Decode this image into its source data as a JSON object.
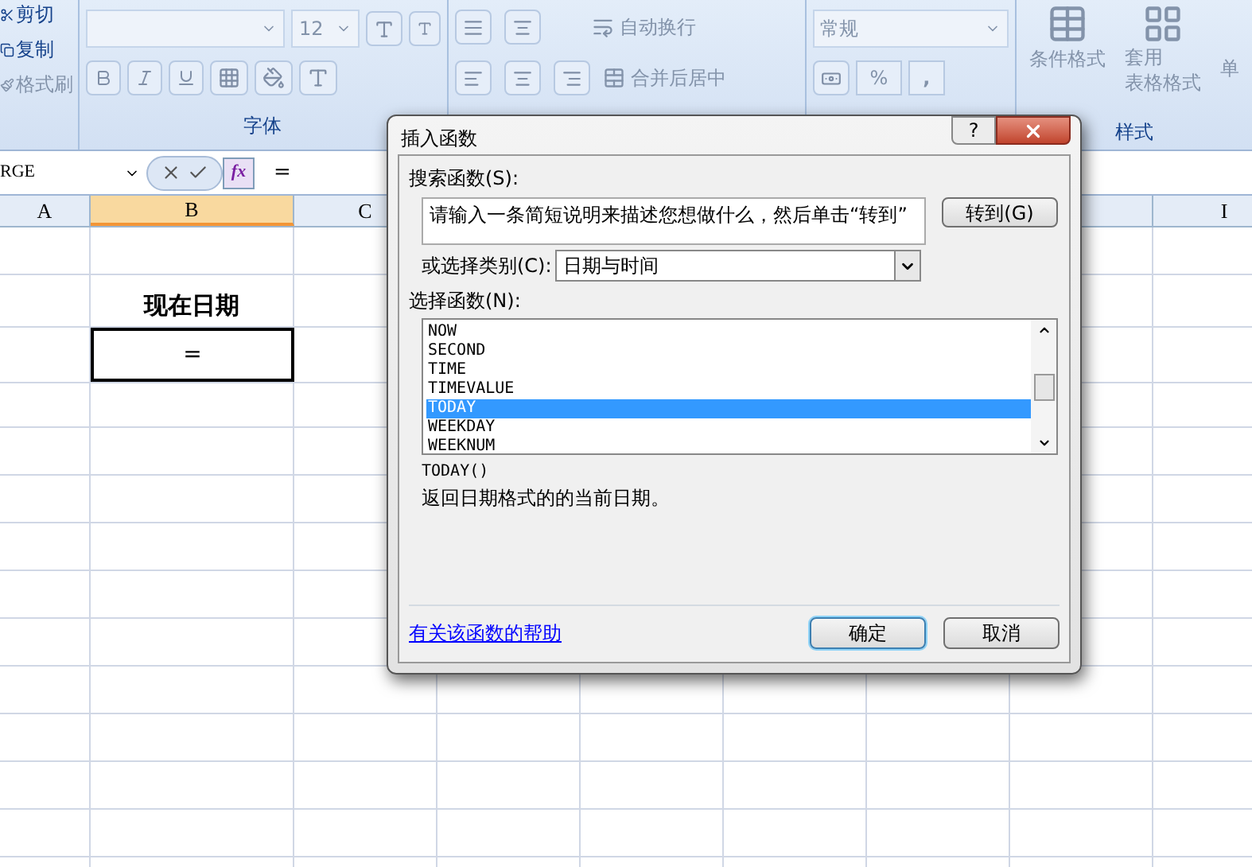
{
  "ribbon": {
    "clipboard": [
      "剪切",
      "复制",
      "格式刷"
    ],
    "font": {
      "size": "12",
      "label": "字体"
    },
    "alignment": {
      "wrap": "自动换行",
      "merge": "合并后居中"
    },
    "number": {
      "format": "常规",
      "percent": "%",
      "comma": ","
    },
    "styles": {
      "conditional": "条件格式",
      "table_format": [
        "套用",
        "表格格式"
      ],
      "cut_label": "单",
      "label": "样式"
    }
  },
  "formula_bar": {
    "name_box": "RGE",
    "function_button": "fx",
    "formula": "="
  },
  "sheet": {
    "columns": [
      {
        "label": "A",
        "selected": false
      },
      {
        "label": "B",
        "selected": true
      },
      {
        "label": "C",
        "selected": false
      },
      {
        "label": "I",
        "selected": false
      }
    ],
    "cells": [
      {
        "text": "现在日期",
        "kind": "heading"
      },
      {
        "text": "=",
        "kind": "active"
      }
    ]
  },
  "dialog": {
    "title": "插入函数",
    "help": "?",
    "search_label": "搜索函数(S):",
    "search_value": "请输入一条简短说明来描述您想做什么，然后单击“转到”",
    "go_button": "转到(G)",
    "category_label": "或选择类别(C):",
    "category": "日期与时间",
    "list_label": "选择函数(N):",
    "functions": [
      {
        "name": "NOW",
        "selected": false
      },
      {
        "name": "SECOND",
        "selected": false
      },
      {
        "name": "TIME",
        "selected": false
      },
      {
        "name": "TIMEVALUE",
        "selected": false
      },
      {
        "name": "TODAY",
        "selected": true
      },
      {
        "name": "WEEKDAY",
        "selected": false
      },
      {
        "name": "WEEKNUM",
        "selected": false
      }
    ],
    "signature": "TODAY()",
    "description": "返回日期格式的的当前日期。",
    "help_link": "有关该函数的帮助",
    "ok": "确定",
    "cancel": "取消"
  }
}
